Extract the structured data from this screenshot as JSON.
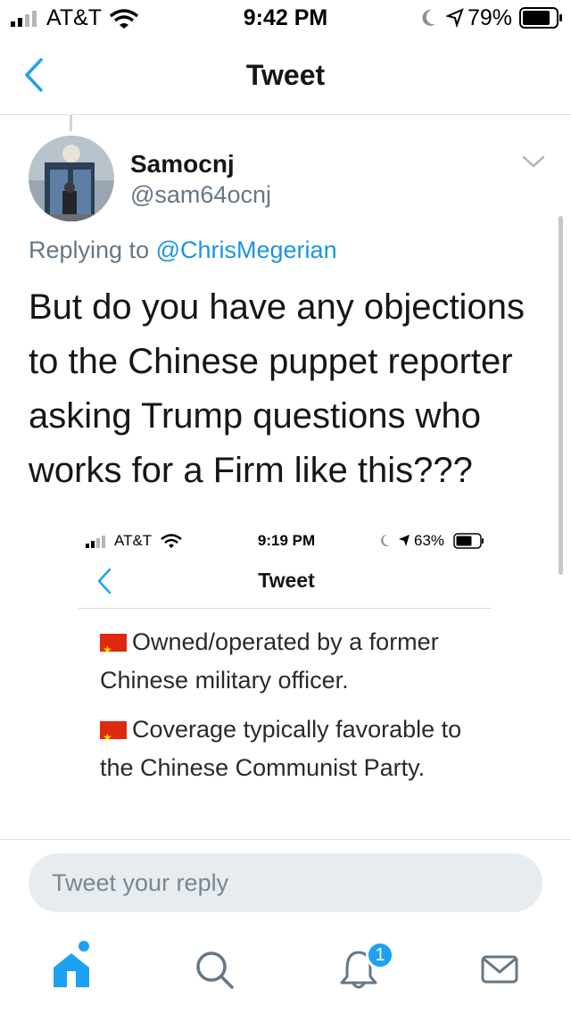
{
  "status_bar": {
    "carrier": "AT&T",
    "time": "9:42 PM",
    "battery": "79%"
  },
  "nav": {
    "title": "Tweet",
    "back_icon": "chevron-left-icon"
  },
  "tweet": {
    "display_name": "Samocnj",
    "handle": "@sam64ocnj",
    "replying_prefix": "Replying to",
    "replying_to": "@ChrisMegerian",
    "text": "But do you have any objections to the Chinese puppet reporter asking Trump questions who works for a Firm like this???"
  },
  "embedded_image": {
    "carrier": "AT&T",
    "time": "9:19 PM",
    "battery": "63%",
    "title": "Tweet",
    "lines": [
      "Owned/operated by a former Chinese military officer.",
      "Coverage typically favorable to the Chinese Communist Party."
    ]
  },
  "reply_box": {
    "placeholder": "Tweet your reply"
  },
  "tab_bar": {
    "items": [
      "home-icon",
      "search-icon",
      "notifications-icon",
      "messages-icon"
    ],
    "notification_count": "1"
  },
  "colors": {
    "accent": "#1da1f2",
    "text": "#14171a",
    "secondary_text": "#657786"
  }
}
